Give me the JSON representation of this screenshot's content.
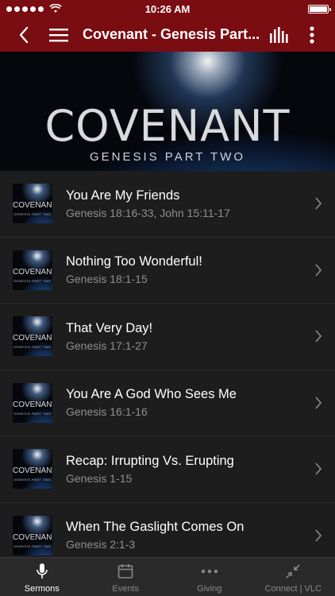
{
  "status": {
    "time": "10:26 AM"
  },
  "nav": {
    "title": "Covenant - Genesis Part..."
  },
  "hero": {
    "title": "COVENANT",
    "subtitle": "GENESIS PART TWO"
  },
  "thumb": {
    "title": "COVENANT",
    "subtitle": "GENESIS PART TWO"
  },
  "sermons": [
    {
      "title": "You Are My Friends",
      "reference": "Genesis 18:16-33, John 15:11-17"
    },
    {
      "title": "Nothing Too Wonderful!",
      "reference": "Genesis 18:1-15"
    },
    {
      "title": "That Very Day!",
      "reference": "Genesis 17:1-27"
    },
    {
      "title": "You Are A God Who Sees Me",
      "reference": "Genesis 16:1-16"
    },
    {
      "title": "Recap: Irrupting Vs. Erupting",
      "reference": "Genesis 1-15"
    },
    {
      "title": "When The Gaslight Comes On",
      "reference": "Genesis 2:1-3"
    }
  ],
  "tabs": [
    {
      "label": "Sermons",
      "icon": "microphone-icon",
      "active": true
    },
    {
      "label": "Events",
      "icon": "calendar-icon",
      "active": false
    },
    {
      "label": "Giving",
      "icon": "more-dots-icon",
      "active": false
    },
    {
      "label": "Connect | VLC",
      "icon": "connect-arrows-icon",
      "active": false
    }
  ],
  "colors": {
    "brand": "#7a0d12",
    "background": "#1d1d1d",
    "tabbar": "#2a2a2a"
  }
}
